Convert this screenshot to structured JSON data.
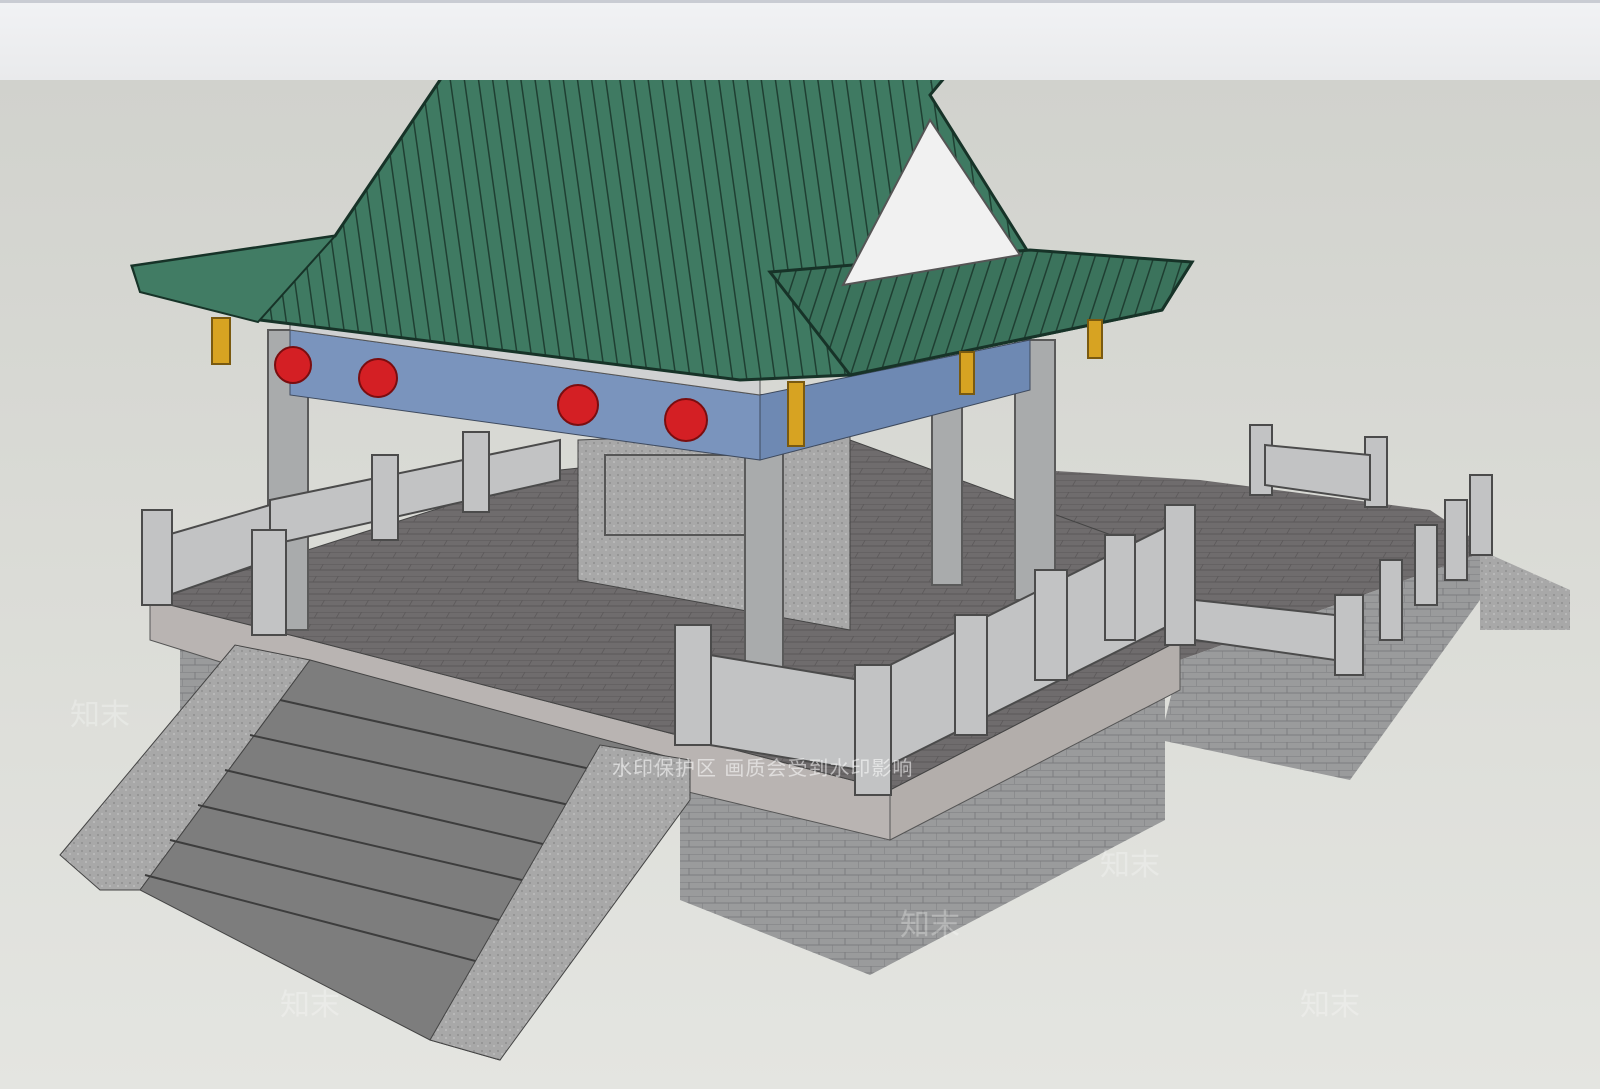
{
  "viewport": {
    "background_top": "#d1d2cd",
    "background_bottom": "#e4e5e1"
  },
  "model": {
    "roof_color": "#3f7a62",
    "beam_color": "#7a94bd",
    "lantern_color": "#d41f24",
    "gold_color": "#d7a322",
    "stone_color": "#a6a6a6",
    "icons": [
      "pavilion-model",
      "red-lantern",
      "stone-railing",
      "stone-staircase"
    ]
  },
  "watermark": {
    "banner": "水印保护区   画质会受到水印影响",
    "brand": "知末"
  }
}
